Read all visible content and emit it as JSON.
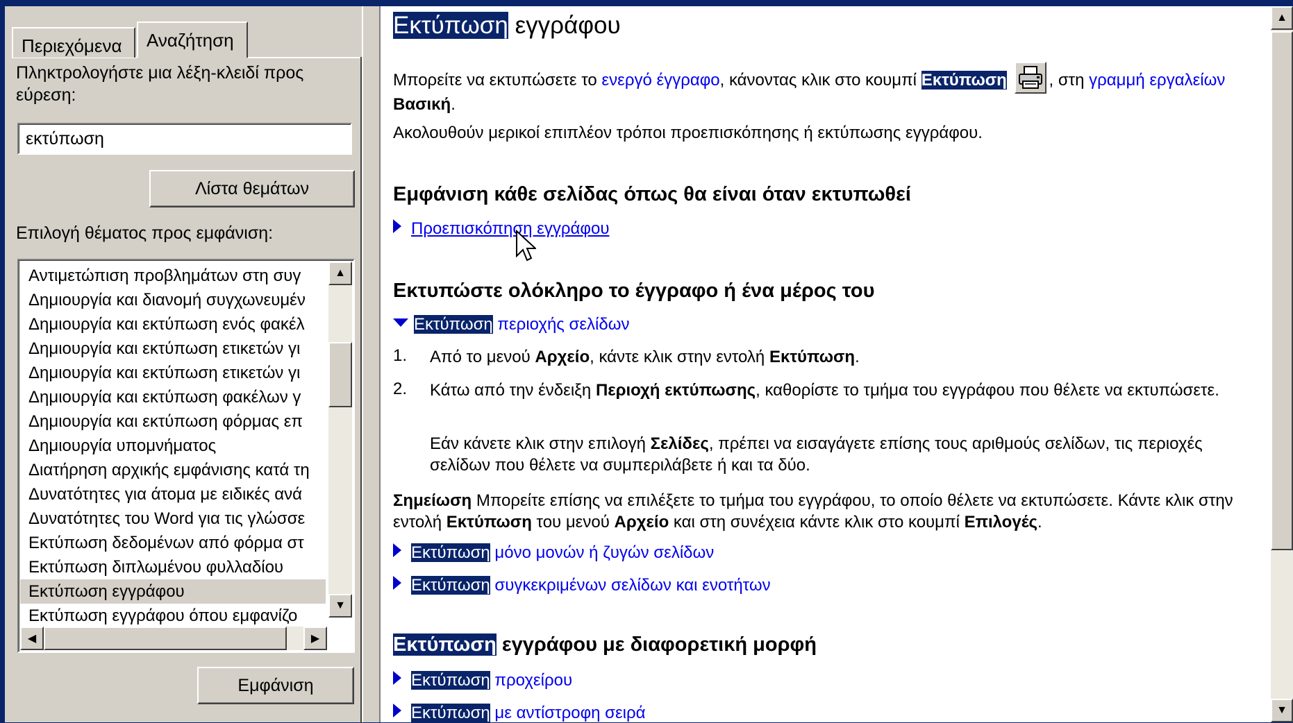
{
  "left": {
    "tabs": [
      "Περιεχόμενα",
      "Αναζήτηση"
    ],
    "keyword_prompt": "Πληκτρολογήστε μια λέξη-κλειδί προς εύρεση:",
    "search_value": "εκτύπωση",
    "list_topics_button": "Λίστα θεμάτων",
    "select_topic_label": "Επιλογή θέματος προς εμφάνιση:",
    "topics": [
      "Αντιμετώπιση προβλημάτων στη συγ",
      "Δημιουργία και διανομή συγχωνευμέν",
      "Δημιουργία και εκτύπωση ενός φακέλ",
      "Δημιουργία και εκτύπωση ετικετών γι",
      "Δημιουργία και εκτύπωση ετικετών γι",
      "Δημιουργία και εκτύπωση φακέλων γ",
      "Δημιουργία και εκτύπωση φόρμας επ",
      "Δημιουργία υπομνήματος",
      "Διατήρηση αρχικής εμφάνισης κατά τη",
      "Δυνατότητες για άτομα με ειδικές ανά",
      "Δυνατότητες του Word για τις γλώσσε",
      "Εκτύπωση δεδομένων από φόρμα στ",
      "Εκτύπωση διπλωμένου φυλλαδίου",
      "Εκτύπωση εγγράφου",
      "Εκτύπωση εγγράφου όπου εμφανίζο"
    ],
    "selected_topic_index": 13,
    "display_button": "Εμφάνιση"
  },
  "content": {
    "title_highlight": "Εκτύπωση",
    "title_rest": " εγγράφου",
    "intro": {
      "t1": "Μπορείτε να εκτυπώσετε το ",
      "link1": "ενεργό έγγραφο",
      "t2": ", κάνοντας κλικ στο κουμπί ",
      "hl": "Εκτύπωση",
      "t3": ", στη ",
      "link2": "γραμμή εργαλείων",
      "t4": " ",
      "bold": "Βασική",
      "t5": "."
    },
    "intro2": "Ακολουθούν μερικοί επιπλέον τρόποι προεπισκόπησης ή εκτύπωσης εγγράφου.",
    "section1": "Εμφάνιση κάθε σελίδας όπως θα είναι όταν εκτυπωθεί",
    "preview_link": "Προεπισκόπηση εγγράφου",
    "section2": "Εκτυπώστε ολόκληρο το έγγραφο ή ένα μέρος του",
    "expand_range": {
      "hl": "Εκτύπωση",
      "rest": " περιοχής σελίδων"
    },
    "step1": {
      "num": "1.",
      "t1": "Από το μενού ",
      "b1": "Αρχείο",
      "t2": ", κάντε κλικ στην εντολή ",
      "b2": "Εκτύπωση",
      "t3": "."
    },
    "step2": {
      "num": "2.",
      "t1": "Κάτω από την ένδειξη ",
      "b1": "Περιοχή εκτύπωσης",
      "t2": ", καθορίστε το τμήμα του εγγράφου που θέλετε να εκτυπώσετε."
    },
    "step2b": {
      "t1": "Εάν κάνετε κλικ στην επιλογή ",
      "b1": "Σελίδες",
      "t2": ", πρέπει να εισαγάγετε επίσης τους αριθμούς σελίδων, τις περιοχές σελίδων που θέλετε να συμπεριλάβετε ή και τα δύο."
    },
    "note": {
      "label": "Σημείωση",
      "t1": "   Μπορείτε επίσης να επιλέξετε το τμήμα του εγγράφου, το οποίο θέλετε να εκτυπώσετε. Κάντε κλικ στην εντολή ",
      "b1": "Εκτύπωση",
      "t2": " του μενού ",
      "b2": "Αρχείο",
      "t3": " και στη συνέχεια κάντε κλικ στο κουμπί ",
      "b3": "Επιλογές",
      "t4": "."
    },
    "expand_odd_even": {
      "hl": "Εκτύπωση",
      "rest": " μόνο μονών ή ζυγών σελίδων"
    },
    "expand_specific": {
      "hl": "Εκτύπωση",
      "rest": " συγκεκριμένων σελίδων και ενοτήτων"
    },
    "section3": {
      "hl": "Εκτύπωση",
      "rest": " εγγράφου με διαφορετική μορφή"
    },
    "expand_draft": {
      "hl": "Εκτύπωση",
      "rest": " προχείρου"
    },
    "expand_reverse": {
      "hl": "Εκτύπωση",
      "rest": " με αντίστροφη σειρά"
    }
  },
  "icons": {
    "print": "printer-icon",
    "expand": "triangle-right-icon",
    "collapse": "triangle-down-icon",
    "cursor": "mouse-pointer-icon"
  },
  "colors": {
    "highlight": "#0a246a",
    "link": "#0000ee",
    "panel": "#d4d0c8"
  }
}
